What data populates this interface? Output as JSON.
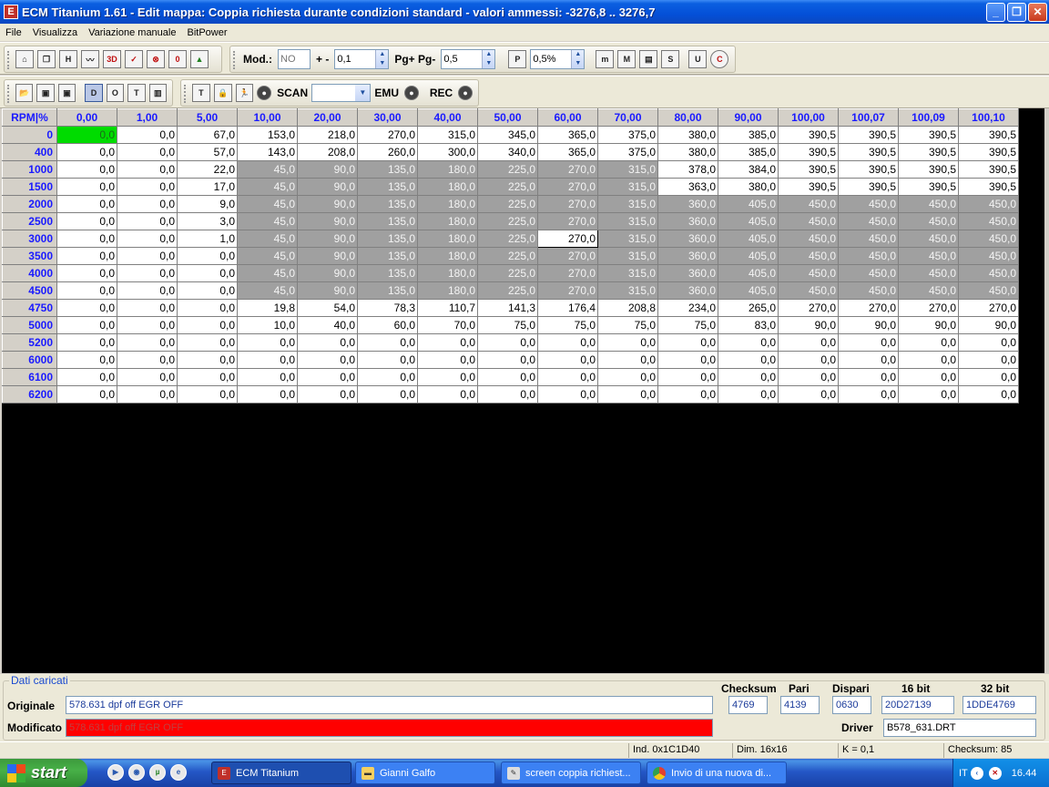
{
  "window": {
    "title": "ECM Titanium 1.61 - Edit mappa: Coppia richiesta durante condizioni standard - valori ammessi: -3276,8 .. 3276,7",
    "minimize": "_",
    "maximize": "❐",
    "close": "✕"
  },
  "menu": [
    "File",
    "Visualizza",
    "Variazione manuale",
    "BitPower"
  ],
  "toolbar1": {
    "mod_label": "Mod.:",
    "mod_value": "NO",
    "plusminus_label": "+ -",
    "plusminus_value": "0,1",
    "pg_label": "Pg+ Pg-",
    "pg_value": "0,5",
    "percent_value": "0,5%"
  },
  "toolbar2": {
    "scan_label": "SCAN",
    "scan_value": "",
    "emu_label": "EMU",
    "rec_label": "REC"
  },
  "grid": {
    "corner": "RPM|%",
    "columns": [
      "0,00",
      "1,00",
      "5,00",
      "10,00",
      "20,00",
      "30,00",
      "40,00",
      "50,00",
      "60,00",
      "70,00",
      "80,00",
      "90,00",
      "100,00",
      "100,07",
      "100,09",
      "100,10"
    ],
    "rows": [
      {
        "rpm": "0",
        "values": [
          "0,0",
          "0,0",
          "67,0",
          "153,0",
          "218,0",
          "270,0",
          "315,0",
          "345,0",
          "365,0",
          "375,0",
          "380,0",
          "385,0",
          "390,5",
          "390,5",
          "390,5",
          "390,5"
        ]
      },
      {
        "rpm": "400",
        "values": [
          "0,0",
          "0,0",
          "57,0",
          "143,0",
          "208,0",
          "260,0",
          "300,0",
          "340,0",
          "365,0",
          "375,0",
          "380,0",
          "385,0",
          "390,5",
          "390,5",
          "390,5",
          "390,5"
        ]
      },
      {
        "rpm": "1000",
        "values": [
          "0,0",
          "0,0",
          "22,0",
          "45,0",
          "90,0",
          "135,0",
          "180,0",
          "225,0",
          "270,0",
          "315,0",
          "378,0",
          "384,0",
          "390,5",
          "390,5",
          "390,5",
          "390,5"
        ]
      },
      {
        "rpm": "1500",
        "values": [
          "0,0",
          "0,0",
          "17,0",
          "45,0",
          "90,0",
          "135,0",
          "180,0",
          "225,0",
          "270,0",
          "315,0",
          "363,0",
          "380,0",
          "390,5",
          "390,5",
          "390,5",
          "390,5"
        ]
      },
      {
        "rpm": "2000",
        "values": [
          "0,0",
          "0,0",
          "9,0",
          "45,0",
          "90,0",
          "135,0",
          "180,0",
          "225,0",
          "270,0",
          "315,0",
          "360,0",
          "405,0",
          "450,0",
          "450,0",
          "450,0",
          "450,0"
        ]
      },
      {
        "rpm": "2500",
        "values": [
          "0,0",
          "0,0",
          "3,0",
          "45,0",
          "90,0",
          "135,0",
          "180,0",
          "225,0",
          "270,0",
          "315,0",
          "360,0",
          "405,0",
          "450,0",
          "450,0",
          "450,0",
          "450,0"
        ]
      },
      {
        "rpm": "3000",
        "values": [
          "0,0",
          "0,0",
          "1,0",
          "45,0",
          "90,0",
          "135,0",
          "180,0",
          "225,0",
          "270,0",
          "315,0",
          "360,0",
          "405,0",
          "450,0",
          "450,0",
          "450,0",
          "450,0"
        ]
      },
      {
        "rpm": "3500",
        "values": [
          "0,0",
          "0,0",
          "0,0",
          "45,0",
          "90,0",
          "135,0",
          "180,0",
          "225,0",
          "270,0",
          "315,0",
          "360,0",
          "405,0",
          "450,0",
          "450,0",
          "450,0",
          "450,0"
        ]
      },
      {
        "rpm": "4000",
        "values": [
          "0,0",
          "0,0",
          "0,0",
          "45,0",
          "90,0",
          "135,0",
          "180,0",
          "225,0",
          "270,0",
          "315,0",
          "360,0",
          "405,0",
          "450,0",
          "450,0",
          "450,0",
          "450,0"
        ]
      },
      {
        "rpm": "4500",
        "values": [
          "0,0",
          "0,0",
          "0,0",
          "45,0",
          "90,0",
          "135,0",
          "180,0",
          "225,0",
          "270,0",
          "315,0",
          "360,0",
          "405,0",
          "450,0",
          "450,0",
          "450,0",
          "450,0"
        ]
      },
      {
        "rpm": "4750",
        "values": [
          "0,0",
          "0,0",
          "0,0",
          "19,8",
          "54,0",
          "78,3",
          "110,7",
          "141,3",
          "176,4",
          "208,8",
          "234,0",
          "265,0",
          "270,0",
          "270,0",
          "270,0",
          "270,0"
        ]
      },
      {
        "rpm": "5000",
        "values": [
          "0,0",
          "0,0",
          "0,0",
          "10,0",
          "40,0",
          "60,0",
          "70,0",
          "75,0",
          "75,0",
          "75,0",
          "75,0",
          "83,0",
          "90,0",
          "90,0",
          "90,0",
          "90,0"
        ]
      },
      {
        "rpm": "5200",
        "values": [
          "0,0",
          "0,0",
          "0,0",
          "0,0",
          "0,0",
          "0,0",
          "0,0",
          "0,0",
          "0,0",
          "0,0",
          "0,0",
          "0,0",
          "0,0",
          "0,0",
          "0,0",
          "0,0"
        ]
      },
      {
        "rpm": "6000",
        "values": [
          "0,0",
          "0,0",
          "0,0",
          "0,0",
          "0,0",
          "0,0",
          "0,0",
          "0,0",
          "0,0",
          "0,0",
          "0,0",
          "0,0",
          "0,0",
          "0,0",
          "0,0",
          "0,0"
        ]
      },
      {
        "rpm": "6100",
        "values": [
          "0,0",
          "0,0",
          "0,0",
          "0,0",
          "0,0",
          "0,0",
          "0,0",
          "0,0",
          "0,0",
          "0,0",
          "0,0",
          "0,0",
          "0,0",
          "0,0",
          "0,0",
          "0,0"
        ]
      },
      {
        "rpm": "6200",
        "values": [
          "0,0",
          "0,0",
          "0,0",
          "0,0",
          "0,0",
          "0,0",
          "0,0",
          "0,0",
          "0,0",
          "0,0",
          "0,0",
          "0,0",
          "0,0",
          "0,0",
          "0,0",
          "0,0"
        ]
      }
    ],
    "modified_ranges": [
      {
        "row": 2,
        "from": 3,
        "to": 9
      },
      {
        "row": 3,
        "from": 3,
        "to": 9
      },
      {
        "row": 4,
        "from": 3,
        "to": 15
      },
      {
        "row": 5,
        "from": 3,
        "to": 15
      },
      {
        "row": 6,
        "from": 3,
        "to": 15
      },
      {
        "row": 7,
        "from": 3,
        "to": 15
      },
      {
        "row": 8,
        "from": 3,
        "to": 15
      },
      {
        "row": 9,
        "from": 3,
        "to": 15
      }
    ],
    "selected_cell": {
      "row": 0,
      "col": 0
    },
    "cursor_cell": {
      "row": 6,
      "col": 8
    }
  },
  "bottom": {
    "legend": "Dati caricati",
    "originale_label": "Originale",
    "originale_value": "578.631 dpf off EGR OFF",
    "modificato_label": "Modificato",
    "modificato_value": "578.631 dpf off EGR OFF",
    "checksum_label": "Checksum",
    "checksum_value": "4769",
    "pari_label": "Pari",
    "pari_value": "4139",
    "dispari_label": "Dispari",
    "dispari_value": "0630",
    "bit16_label": "16 bit",
    "bit16_value": "20D27139",
    "bit32_label": "32 bit",
    "bit32_value": "1DDE4769",
    "driver_label": "Driver",
    "driver_value": "B578_631.DRT"
  },
  "status": {
    "ind": "Ind. 0x1C1D40",
    "dim": "Dim. 16x16",
    "k": "K = 0,1",
    "checksum": "Checksum: 85"
  },
  "taskbar": {
    "start": "start",
    "tasks": [
      "ECM Titanium",
      "Gianni Galfo",
      "screen coppia richiest...",
      "Invio di una nuova di..."
    ],
    "lang": "IT",
    "clock": "16.44"
  },
  "colors": {
    "selected": "#00dc00",
    "modified": "#a0a0a0",
    "header_text": "#1a1aff",
    "modified_field": "#ff0000"
  }
}
